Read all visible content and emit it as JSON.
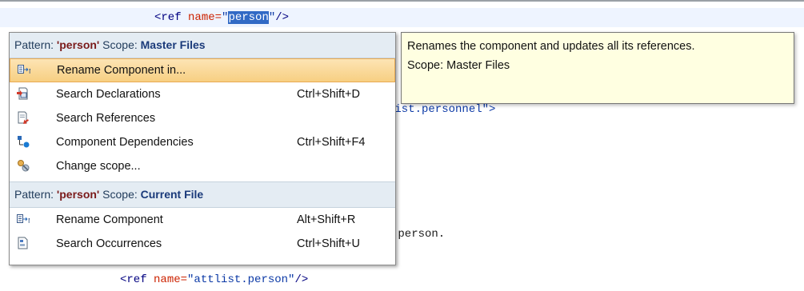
{
  "editor": {
    "line1": {
      "open": "<ref ",
      "attr": "name=",
      "q1": "\"",
      "selected": "person",
      "q2": "\"",
      "close": "/>"
    },
    "line2_fragment": "list.personnel\">",
    "line3_fragment": " person.",
    "line4": {
      "open": "<ref ",
      "attr": "name=",
      "value": "\"attlist.person\"",
      "close": "/>"
    }
  },
  "popup": {
    "sections": [
      {
        "header": {
          "pattern_label": "Pattern:",
          "pattern_value": "'person'",
          "scope_label": "Scope:",
          "scope_value": "Master Files"
        },
        "items": [
          {
            "icon": "rename-icon",
            "label": "Rename Component in...",
            "shortcut": ""
          },
          {
            "icon": "search-declarations-icon",
            "label": "Search Declarations",
            "shortcut": "Ctrl+Shift+D"
          },
          {
            "icon": "search-references-icon",
            "label": "Search References",
            "shortcut": ""
          },
          {
            "icon": "component-dependencies-icon",
            "label": "Component Dependencies",
            "shortcut": "Ctrl+Shift+F4"
          },
          {
            "icon": "change-scope-icon",
            "label": "Change scope...",
            "shortcut": ""
          }
        ]
      },
      {
        "header": {
          "pattern_label": "Pattern:",
          "pattern_value": "'person'",
          "scope_label": "Scope:",
          "scope_value": "Current File"
        },
        "items": [
          {
            "icon": "rename-icon",
            "label": "Rename Component",
            "shortcut": "Alt+Shift+R"
          },
          {
            "icon": "search-occurrences-icon",
            "label": "Search Occurrences",
            "shortcut": "Ctrl+Shift+U"
          }
        ]
      }
    ]
  },
  "tooltip": {
    "line1": "Renames the component and updates all its references.",
    "line2": "Scope: Master Files"
  },
  "colors": {
    "selection": "#316ac5",
    "highlight_row": "#f7cf82",
    "tooltip_bg": "#ffffe1",
    "header_bg": "#e4ecf3"
  }
}
